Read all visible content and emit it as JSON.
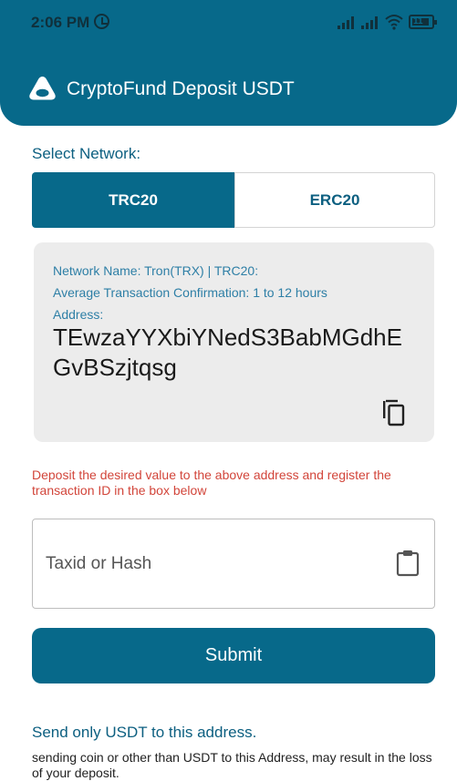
{
  "status_bar": {
    "time": "2:06 PM",
    "battery": "11",
    "icons": [
      "alarm-icon",
      "signal-icon",
      "signal-icon",
      "wifi-icon",
      "battery-icon"
    ]
  },
  "header": {
    "title": "CryptoFund Deposit USDT",
    "logo_icon": "crypto-logo-icon"
  },
  "network": {
    "label": "Select Network:",
    "tabs": [
      {
        "label": "TRC20",
        "active": true
      },
      {
        "label": "ERC20",
        "active": false
      }
    ]
  },
  "details": {
    "network_name": "Network Name: Tron(TRX) | TRC20:",
    "confirmation": "Average Transaction Confirmation: 1 to 12 hours",
    "address_label": "Address:",
    "address": "TEwzaYYXbiYNedS3BabMGdhEGvBSzjtqsg",
    "copy_icon": "copy-icon"
  },
  "instruction": "Deposit the desired value to the above address and register the transaction ID in the box below",
  "tx_input": {
    "placeholder": "Taxid or Hash",
    "value": "",
    "paste_icon": "clipboard-icon"
  },
  "submit_label": "Submit",
  "warning": {
    "title": "Send only USDT to this address.",
    "text": "sending coin or other than USDT to this Address, may result in the loss of your deposit."
  },
  "colors": {
    "primary": "#07698a",
    "accent_text": "#0c5f80",
    "info_text": "#2e7fa6",
    "error": "#d2453a",
    "card_bg": "#ececec"
  }
}
